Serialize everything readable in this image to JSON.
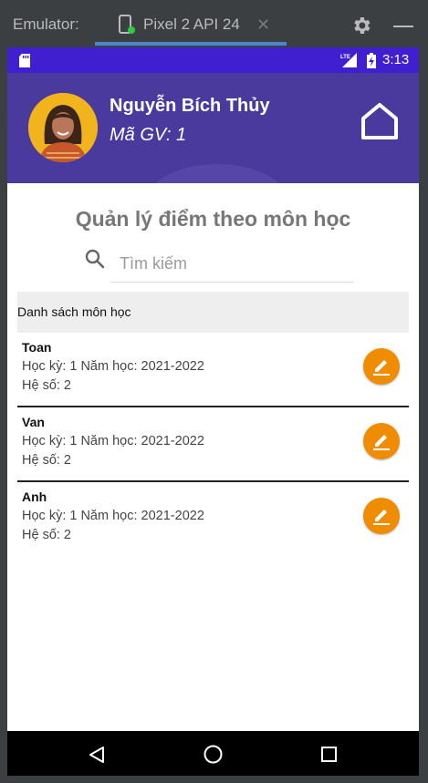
{
  "emulator": {
    "label": "Emulator:",
    "device_tab": "Pixel 2 API 24",
    "close_glyph": "✕",
    "icons": [
      "phone-icon",
      "gear-icon",
      "minimize-icon"
    ],
    "accent_color": "#4a88c7"
  },
  "status_bar": {
    "time": "3:13",
    "icons": [
      "sd-card-icon",
      "lte-signal-icon",
      "battery-charging-icon"
    ],
    "color": "#3f1fd0"
  },
  "header": {
    "name": "Nguyễn Bích Thủy",
    "teacher_id": "Mã GV: 1",
    "color": "#4a3a9e",
    "home_icon": "home-icon"
  },
  "page": {
    "title": "Quản lý điểm theo môn học",
    "search_placeholder": "Tìm kiếm",
    "list_header": "Danh sách môn học"
  },
  "subjects": [
    {
      "name": "Toan",
      "term_line": "Học kỳ: 1 Năm học: 2021-2022",
      "coef_line": "Hệ số: 2"
    },
    {
      "name": "Van",
      "term_line": "Học kỳ: 1 Năm học: 2021-2022",
      "coef_line": "Hệ số: 2"
    },
    {
      "name": "Anh",
      "term_line": "Học kỳ: 1 Năm học: 2021-2022",
      "coef_line": "Hệ số: 2"
    }
  ],
  "edit_button_color": "#ef8c00",
  "nav_bar": {
    "icons": [
      "back-icon",
      "home-circle-icon",
      "recent-apps-icon"
    ]
  }
}
